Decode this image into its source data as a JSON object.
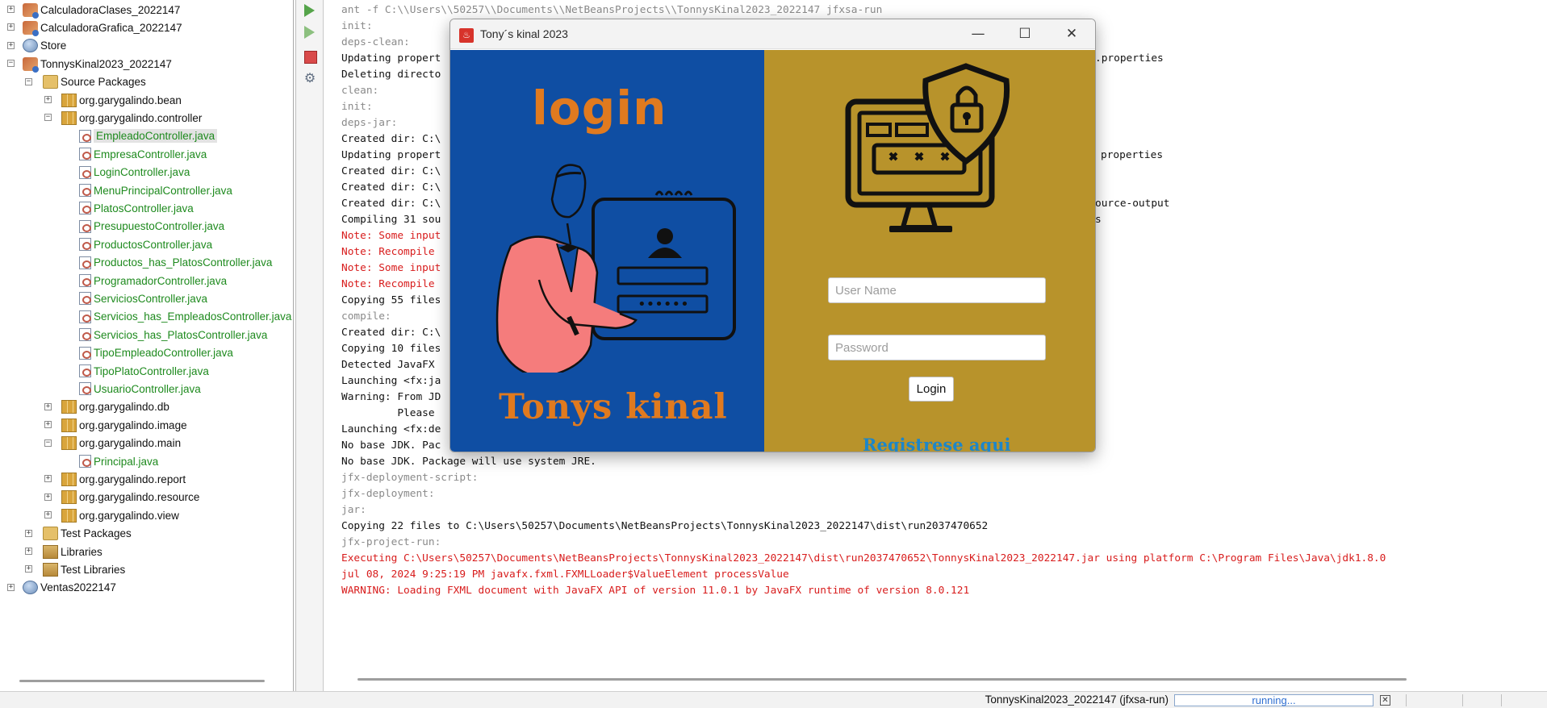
{
  "projects": {
    "items": [
      {
        "label": "CalculadoraClases_2022147",
        "toggle": "+"
      },
      {
        "label": "CalculadoraGrafica_2022147",
        "toggle": "+"
      },
      {
        "label": "Store",
        "toggle": "+"
      },
      {
        "label": "TonnysKinal2023_2022147",
        "toggle": "−"
      },
      {
        "label": "Source Packages",
        "toggle": "−"
      },
      {
        "label": "org.garygalindo.bean",
        "toggle": "+"
      },
      {
        "label": "org.garygalindo.controller",
        "toggle": "−"
      },
      {
        "label": "EmpleadoController.java"
      },
      {
        "label": "EmpresaController.java"
      },
      {
        "label": "LoginController.java"
      },
      {
        "label": "MenuPrincipalController.java"
      },
      {
        "label": "PlatosController.java"
      },
      {
        "label": "PresupuestoController.java"
      },
      {
        "label": "ProductosController.java"
      },
      {
        "label": "Productos_has_PlatosController.java"
      },
      {
        "label": "ProgramadorController.java"
      },
      {
        "label": "ServiciosController.java"
      },
      {
        "label": "Servicios_has_EmpleadosController.java"
      },
      {
        "label": "Servicios_has_PlatosController.java"
      },
      {
        "label": "TipoEmpleadoController.java"
      },
      {
        "label": "TipoPlatoController.java"
      },
      {
        "label": "UsuarioController.java"
      },
      {
        "label": "org.garygalindo.db",
        "toggle": "+"
      },
      {
        "label": "org.garygalindo.image",
        "toggle": "+"
      },
      {
        "label": "org.garygalindo.main",
        "toggle": "−"
      },
      {
        "label": "Principal.java"
      },
      {
        "label": "org.garygalindo.report",
        "toggle": "+"
      },
      {
        "label": "org.garygalindo.resource",
        "toggle": "+"
      },
      {
        "label": "org.garygalindo.view",
        "toggle": "+"
      },
      {
        "label": "Test Packages",
        "toggle": "+"
      },
      {
        "label": "Libraries",
        "toggle": "+"
      },
      {
        "label": "Test Libraries",
        "toggle": "+"
      },
      {
        "label": "Ventas2022147",
        "toggle": "+"
      }
    ]
  },
  "output": {
    "toolbar": {
      "gear_glyph": "⚙"
    },
    "lines": [
      {
        "text": "ant -f C:\\\\Users\\\\50257\\\\Documents\\\\NetBeansProjects\\\\TonnysKinal2023_2022147 jfxsa-run",
        "style": "gray"
      },
      {
        "text": "init:",
        "style": "gray"
      },
      {
        "text": "deps-clean:",
        "style": "gray"
      },
      {
        "text": "Updating propert",
        "style": "black",
        "right": ".properties",
        "right_style": "black"
      },
      {
        "text": "Deleting directo",
        "style": "black"
      },
      {
        "text": "clean:",
        "style": "gray"
      },
      {
        "text": "init:",
        "style": "gray"
      },
      {
        "text": "deps-jar:",
        "style": "gray"
      },
      {
        "text": "Created dir: C:\\",
        "style": "black"
      },
      {
        "text": "Updating propert",
        "style": "black",
        "right": "properties",
        "right_style": "black"
      },
      {
        "text": "Created dir: C:\\",
        "style": "black"
      },
      {
        "text": "Created dir: C:\\",
        "style": "black"
      },
      {
        "text": "Created dir: C:\\",
        "style": "black",
        "right": "ource-output",
        "right_style": "black"
      },
      {
        "text": "Compiling 31 sou",
        "style": "black",
        "right": "s",
        "right_style": "black"
      },
      {
        "text": "Note: Some input",
        "style": "red"
      },
      {
        "text": "Note: Recompile",
        "style": "red"
      },
      {
        "text": "Note: Some input",
        "style": "red"
      },
      {
        "text": "Note: Recompile",
        "style": "red"
      },
      {
        "text": "Copying 55 files",
        "style": "black"
      },
      {
        "text": "compile:",
        "style": "gray"
      },
      {
        "text": "Created dir: C:\\",
        "style": "black"
      },
      {
        "text": "Copying 10 files",
        "style": "black"
      },
      {
        "text": "Detected JavaFX",
        "style": "black"
      },
      {
        "text": "Launching <fx:ja",
        "style": "black"
      },
      {
        "text": "Warning: From JD",
        "style": "black"
      },
      {
        "text": "         Please",
        "style": "black"
      },
      {
        "text": "Launching <fx:de",
        "style": "black"
      },
      {
        "text": "No base JDK. Pac",
        "style": "black"
      },
      {
        "text": "No base JDK. Package will use system JRE.",
        "style": "black"
      },
      {
        "text": "jfx-deployment-script:",
        "style": "gray"
      },
      {
        "text": "jfx-deployment:",
        "style": "gray"
      },
      {
        "text": "jar:",
        "style": "gray"
      },
      {
        "text": "Copying 22 files to C:\\Users\\50257\\Documents\\NetBeansProjects\\TonnysKinal2023_2022147\\dist\\run2037470652",
        "style": "black"
      },
      {
        "text": "jfx-project-run:",
        "style": "gray"
      },
      {
        "text": "Executing C:\\Users\\50257\\Documents\\NetBeansProjects\\TonnysKinal2023_2022147\\dist\\run2037470652\\TonnysKinal2023_2022147.jar using platform C:\\Program Files\\Java\\jdk1.8.0",
        "style": "red"
      },
      {
        "text": "jul 08, 2024 9:25:19 PM javafx.fxml.FXMLLoader$ValueElement processValue",
        "style": "red"
      },
      {
        "text": "WARNING: Loading FXML document with JavaFX API of version 11.0.1 by JavaFX runtime of version 8.0.121",
        "style": "red"
      }
    ]
  },
  "status_bar": {
    "task": "TonnysKinal2023_2022147 (jfxsa-run)",
    "progress_label": "running...",
    "cancel_glyph": "✕"
  },
  "login_window": {
    "title": "Tony´s kinal 2023",
    "app_icon_glyph": "♨",
    "controls": {
      "minimize": "—",
      "maximize": "☐",
      "close": "✕"
    },
    "heading": "login",
    "brand": "Tonys kinal",
    "username_placeholder": "User Name",
    "password_placeholder": "Password",
    "login_button": "Login",
    "register_link": "Registrese aqui",
    "colors": {
      "left_panel": "#0f4ea3",
      "right_panel": "#b8932b",
      "accent_orange": "#e07a1f",
      "link_blue": "#1d86c9"
    },
    "illustration_mask": "••••••"
  }
}
